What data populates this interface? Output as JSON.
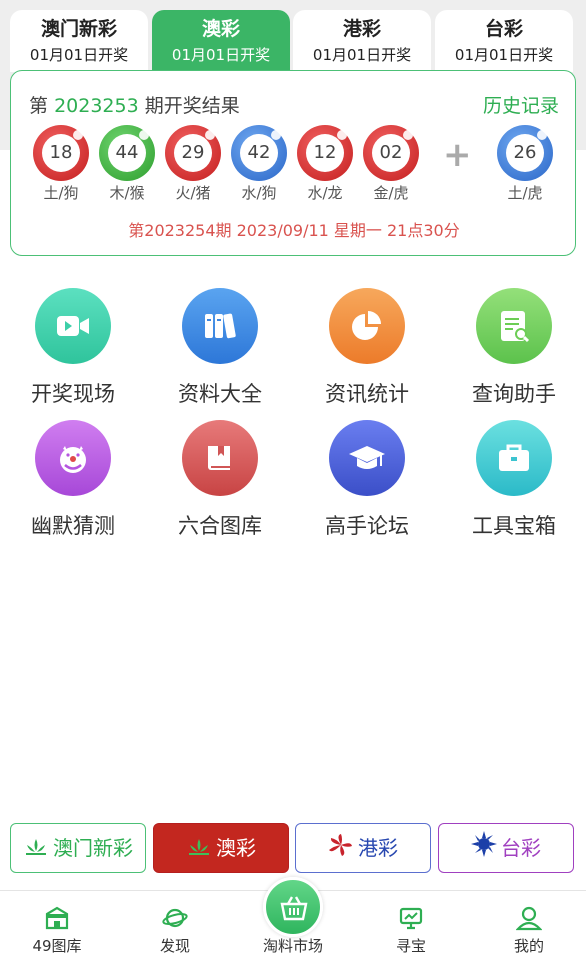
{
  "tabs": [
    {
      "name": "澳门新彩",
      "date": "01月01日开奖"
    },
    {
      "name": "澳彩",
      "date": "01月01日开奖"
    },
    {
      "name": "港彩",
      "date": "01月01日开奖"
    },
    {
      "name": "台彩",
      "date": "01月01日开奖"
    }
  ],
  "result": {
    "prefix": "第",
    "issue": "2023253",
    "suffix": "期开奖结果",
    "history_label": "历史记录",
    "balls": [
      {
        "number": "18",
        "zodiac": "土/狗",
        "color": "red"
      },
      {
        "number": "44",
        "zodiac": "木/猴",
        "color": "green"
      },
      {
        "number": "29",
        "zodiac": "火/猪",
        "color": "red"
      },
      {
        "number": "42",
        "zodiac": "水/狗",
        "color": "blue"
      },
      {
        "number": "12",
        "zodiac": "水/龙",
        "color": "red"
      },
      {
        "number": "02",
        "zodiac": "金/虎",
        "color": "red"
      }
    ],
    "plus": "+",
    "special": {
      "number": "26",
      "zodiac": "土/虎",
      "color": "blue"
    },
    "next_draw": "第2023254期 2023/09/11 星期一 21点30分"
  },
  "grid": [
    {
      "label": "开奖现场",
      "icon": "video-icon"
    },
    {
      "label": "资料大全",
      "icon": "books-icon"
    },
    {
      "label": "资讯统计",
      "icon": "pie-chart-icon"
    },
    {
      "label": "查询助手",
      "icon": "search-doc-icon"
    },
    {
      "label": "幽默猜测",
      "icon": "clown-icon"
    },
    {
      "label": "六合图库",
      "icon": "book-icon"
    },
    {
      "label": "高手论坛",
      "icon": "graduation-cap-icon"
    },
    {
      "label": "工具宝箱",
      "icon": "briefcase-icon"
    }
  ],
  "lottery_switch": [
    "澳门新彩",
    "澳彩",
    "港彩",
    "台彩"
  ],
  "bottom_nav": {
    "items": [
      "49图库",
      "发现",
      "淘料市场",
      "寻宝",
      "我的"
    ]
  },
  "colors": {
    "accent_green": "#3bb566",
    "ball_red": "#c41e1e",
    "ball_green": "#2e9e2e",
    "ball_blue": "#2a66c8",
    "next_draw_red": "#d9534f"
  }
}
